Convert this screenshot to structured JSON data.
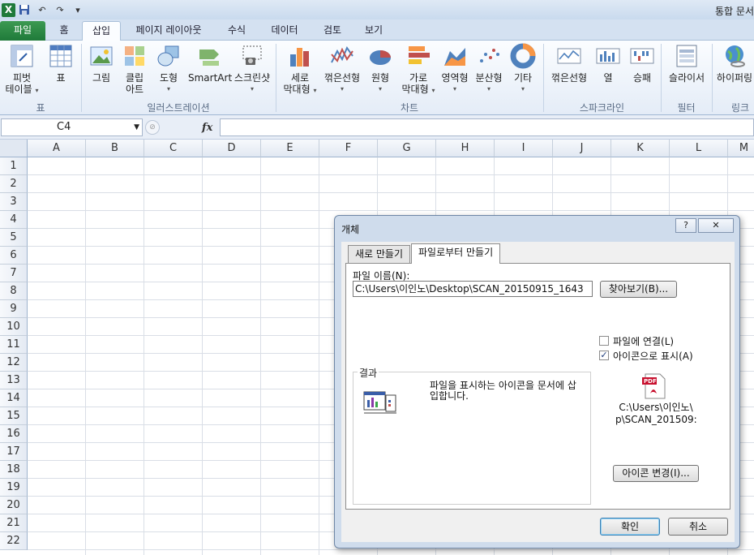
{
  "window": {
    "title": "통합 문서"
  },
  "qat": {
    "undo": "↶",
    "redo": "↷",
    "customize": "▾"
  },
  "ribbon_tabs": [
    "파일",
    "홈",
    "삽입",
    "페이지 레이아웃",
    "수식",
    "데이터",
    "검토",
    "보기"
  ],
  "ribbon": {
    "pivot": [
      "피벗",
      "테이블"
    ],
    "table": "표",
    "picture": "그림",
    "clipart": [
      "클립",
      "아트"
    ],
    "shapes": "도형",
    "smartart": "SmartArt",
    "screenshot": "스크린샷",
    "column": [
      "세로",
      "막대형"
    ],
    "line": "꺾은선형",
    "pie": "원형",
    "bar": [
      "가로",
      "막대형"
    ],
    "area": "영역형",
    "scatter": "분산형",
    "other": "기타",
    "spark_line": "꺾은선형",
    "spark_column": "열",
    "spark_winloss": "승패",
    "slicer": "슬라이서",
    "hyperlink": "하이퍼링",
    "groups": {
      "tables": "표",
      "illustrations": "일러스트레이션",
      "charts": "차트",
      "sparklines": "스파크라인",
      "filter": "필터",
      "links": "링크"
    }
  },
  "formula_bar": {
    "name_box": "C4",
    "fx": "fx"
  },
  "sheet": {
    "columns": [
      "A",
      "B",
      "C",
      "D",
      "E",
      "F",
      "G",
      "H",
      "I",
      "J",
      "K",
      "L",
      "M"
    ],
    "rows": [
      "1",
      "2",
      "3",
      "4",
      "5",
      "6",
      "7",
      "8",
      "9",
      "10",
      "11",
      "12",
      "13",
      "14",
      "15",
      "16",
      "17",
      "18",
      "19",
      "20",
      "21",
      "22"
    ]
  },
  "dialog": {
    "title": "개체",
    "help": "?",
    "close": "✕",
    "tabs": [
      "새로 만들기",
      "파일로부터 만들기"
    ],
    "file_name_label": "파일 이름(N):",
    "file_name_value": "C:\\Users\\이인노\\Desktop\\SCAN_20150915_1643",
    "browse": "찾아보기(B)...",
    "link_to_file": "파일에 연결(L)",
    "link_checked": false,
    "display_as_icon": "아이콘으로 표시(A)",
    "icon_checked": true,
    "result_label": "결과",
    "result_text": "파일을 표시하는 아이콘을 문서에 삽입합니다.",
    "icon_caption_1": "C:\\Users\\이인노\\",
    "icon_caption_2": "p\\SCAN_201509:",
    "change_icon": "아이콘 변경(I)...",
    "ok": "확인",
    "cancel": "취소"
  }
}
